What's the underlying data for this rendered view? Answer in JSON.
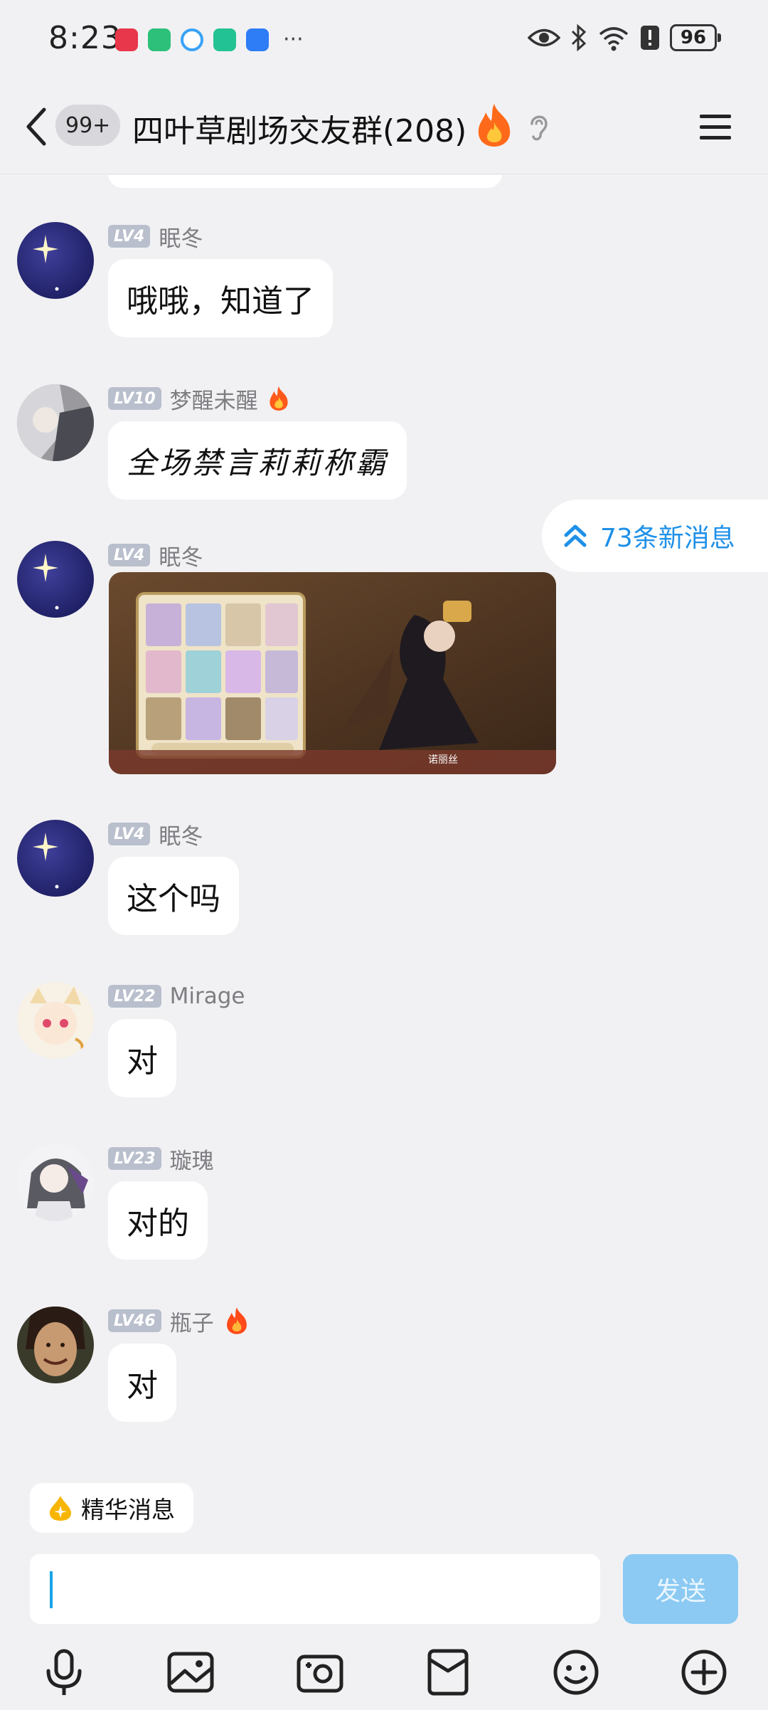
{
  "status_bar": {
    "time": "8:23",
    "battery": "96",
    "more": "···"
  },
  "header": {
    "unread_badge": "99+",
    "group_title": "四叶草剧场交友群(208)"
  },
  "new_messages": {
    "label": "73条新消息"
  },
  "messages": [
    {
      "level": "LV4",
      "nick": "眠冬",
      "text": "哦哦，知道了"
    },
    {
      "level": "LV10",
      "nick": "梦醒未醒",
      "text": "全场禁言莉莉称霸"
    },
    {
      "level": "LV4",
      "nick": "眠冬",
      "image_caption": "诺丽丝"
    },
    {
      "level": "LV4",
      "nick": "眠冬",
      "text": "这个吗"
    },
    {
      "level": "LV22",
      "nick": "Mirage",
      "text": "对"
    },
    {
      "level": "LV23",
      "nick": "璇瑰",
      "text": "对的"
    },
    {
      "level": "LV46",
      "nick": "瓶子",
      "text": "对"
    }
  ],
  "essence": {
    "label": "精华消息"
  },
  "composer": {
    "placeholder": "",
    "send_label": "发送"
  },
  "toolbar": [
    "microphone-icon",
    "image-icon",
    "camera-icon",
    "red-packet-icon",
    "emoji-icon",
    "plus-icon"
  ],
  "colors": {
    "accent": "#1e90e8",
    "send_disabled": "#8ccaf3",
    "level_badge": "#b9bfcc",
    "background": "#f1f1f3"
  }
}
